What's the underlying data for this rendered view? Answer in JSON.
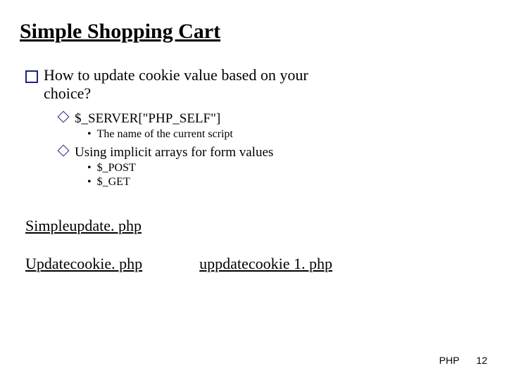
{
  "title": "Simple Shopping Cart",
  "q1": {
    "line1": "How to update cookie value based on your",
    "line2": "choice?",
    "sub": [
      {
        "text": "$_SERVER[\"PHP_SELF\"]",
        "children": [
          "The name of the current script"
        ]
      },
      {
        "text": "Using implicit arrays for form values",
        "children": [
          "$_POST",
          "$_GET"
        ]
      }
    ]
  },
  "links": {
    "a": "Simpleupdate. php",
    "b": "Updatecookie. php",
    "c": "uppdatecookie 1. php"
  },
  "footer": {
    "label": "PHP",
    "page": "12"
  }
}
